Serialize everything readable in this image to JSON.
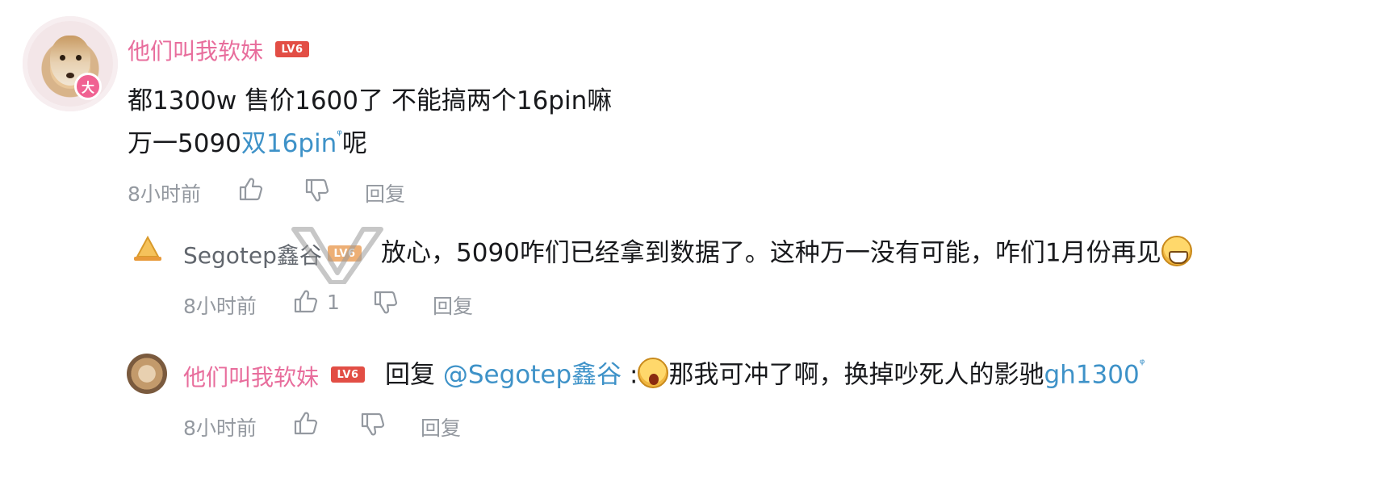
{
  "comments": [
    {
      "username": "他们叫我软妹",
      "level": "LV6",
      "avatar_badge": "大",
      "content_line1": "都1300w 售价1600了 不能搞两个16pin嘛",
      "content_line2_prefix": "万一5090",
      "content_line2_link": "双16pin",
      "content_line2_suffix": "呢",
      "time": "8小时前",
      "reply_label": "回复"
    },
    {
      "username": "Segotep鑫谷",
      "level": "LV6",
      "content": "放心，5090咋们已经拿到数据了。这种万一没有可能，咋们1月份再见",
      "time": "8小时前",
      "like_count": "1",
      "reply_label": "回复"
    },
    {
      "username": "他们叫我软妹",
      "level": "LV6",
      "reply_prefix": "回复",
      "mention": "@Segotep鑫谷",
      "colon": ":",
      "content": "那我可冲了啊，换掉吵死人的影驰",
      "content_link": "gh1300",
      "time": "8小时前",
      "reply_label": "回复"
    }
  ],
  "icons": {
    "search_sup": "ᵠ",
    "like": "thumbs-up-icon",
    "dislike": "thumbs-down-icon"
  },
  "colors": {
    "vip_name": "#e86d9c",
    "link": "#3e92c8",
    "level_badge": "#e24e45",
    "meta": "#9499a0"
  }
}
